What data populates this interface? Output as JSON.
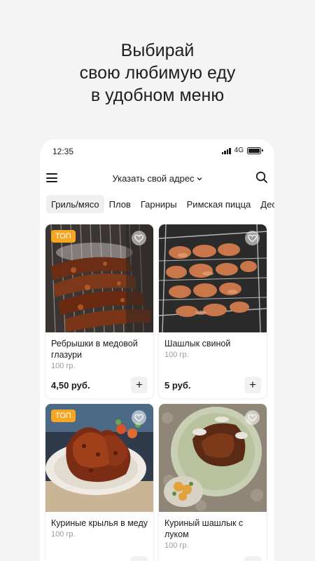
{
  "headline": [
    "Выбирай",
    "свою любимую еду",
    "в удобном меню"
  ],
  "status": {
    "time": "12:35",
    "network": "4G"
  },
  "topbar": {
    "address": "Указать свой адрес"
  },
  "categories": [
    "Гриль/мясо",
    "Плов",
    "Гарниры",
    "Римская пицца",
    "Дес"
  ],
  "products": [
    {
      "badge": "ТОП",
      "title": "Ребрышки в медовой глазури",
      "weight": "100 гр.",
      "price": "4,50 руб."
    },
    {
      "badge": "",
      "title": "Шашлык свиной",
      "weight": "100 гр.",
      "price": "5 руб."
    },
    {
      "badge": "ТОП",
      "title": "Куриные крылья в меду",
      "weight": "100 гр.",
      "price": ""
    },
    {
      "badge": "",
      "title": "Куриный шашлык с луком",
      "weight": "100 гр.",
      "price": ""
    }
  ],
  "colors": {
    "badge": "#f5a623",
    "background": "#f4f4f4",
    "card": "#ffffff"
  },
  "icons": [
    "menu-icon",
    "chevron-down-icon",
    "search-icon",
    "heart-icon",
    "plus-icon",
    "signal-icon",
    "battery-icon"
  ]
}
